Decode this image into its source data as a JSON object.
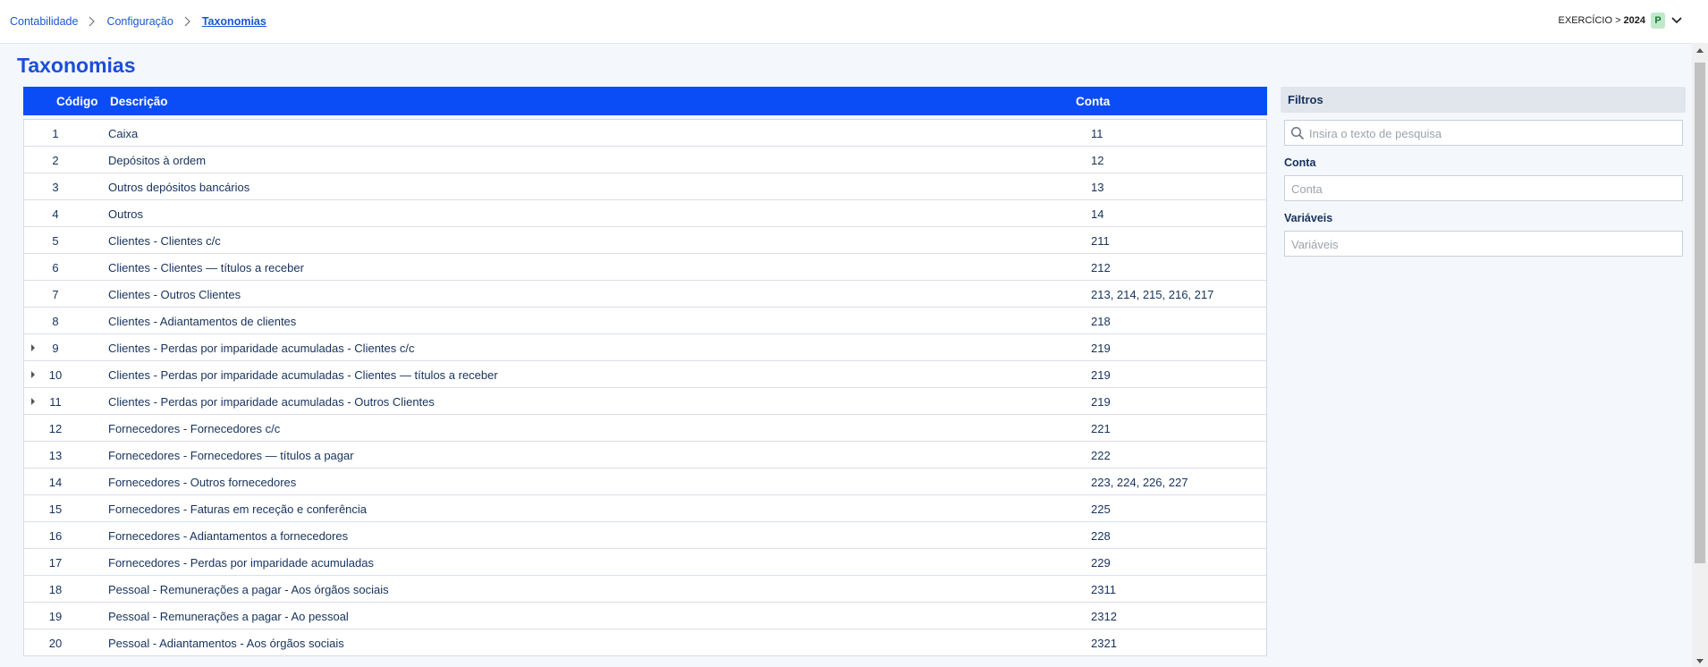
{
  "breadcrumb": {
    "items": [
      "Contabilidade",
      "Configuração",
      "Taxonomias"
    ]
  },
  "exercise": {
    "label": "EXERCÍCIO >",
    "year": "2024",
    "badge": "P"
  },
  "page": {
    "title": "Taxonomias"
  },
  "table": {
    "headers": {
      "code": "Código",
      "description": "Descrição",
      "account": "Conta"
    },
    "rows": [
      {
        "code": "1",
        "description": "Caixa",
        "account": "11",
        "expandable": false
      },
      {
        "code": "2",
        "description": "Depósitos à ordem",
        "account": "12",
        "expandable": false
      },
      {
        "code": "3",
        "description": "Outros depósitos bancários",
        "account": "13",
        "expandable": false
      },
      {
        "code": "4",
        "description": "Outros",
        "account": "14",
        "expandable": false
      },
      {
        "code": "5",
        "description": "Clientes - Clientes c/c",
        "account": "211",
        "expandable": false
      },
      {
        "code": "6",
        "description": "Clientes - Clientes — títulos a receber",
        "account": "212",
        "expandable": false
      },
      {
        "code": "7",
        "description": "Clientes - Outros Clientes",
        "account": "213, 214, 215, 216, 217",
        "expandable": false
      },
      {
        "code": "8",
        "description": "Clientes - Adiantamentos de clientes",
        "account": "218",
        "expandable": false
      },
      {
        "code": "9",
        "description": "Clientes - Perdas por imparidade acumuladas - Clientes c/c",
        "account": "219",
        "expandable": true
      },
      {
        "code": "10",
        "description": "Clientes - Perdas por imparidade acumuladas - Clientes — títulos a receber",
        "account": "219",
        "expandable": true
      },
      {
        "code": "11",
        "description": "Clientes - Perdas por imparidade acumuladas - Outros Clientes",
        "account": "219",
        "expandable": true
      },
      {
        "code": "12",
        "description": "Fornecedores - Fornecedores c/c",
        "account": "221",
        "expandable": false
      },
      {
        "code": "13",
        "description": "Fornecedores - Fornecedores — títulos a pagar",
        "account": "222",
        "expandable": false
      },
      {
        "code": "14",
        "description": "Fornecedores - Outros fornecedores",
        "account": "223, 224, 226, 227",
        "expandable": false
      },
      {
        "code": "15",
        "description": "Fornecedores - Faturas em receção e conferência",
        "account": "225",
        "expandable": false
      },
      {
        "code": "16",
        "description": "Fornecedores - Adiantamentos a fornecedores",
        "account": "228",
        "expandable": false
      },
      {
        "code": "17",
        "description": "Fornecedores - Perdas por imparidade acumuladas",
        "account": "229",
        "expandable": false
      },
      {
        "code": "18",
        "description": "Pessoal - Remunerações a pagar - Aos órgãos sociais",
        "account": "2311",
        "expandable": false
      },
      {
        "code": "19",
        "description": "Pessoal - Remunerações a pagar - Ao pessoal",
        "account": "2312",
        "expandable": false
      },
      {
        "code": "20",
        "description": "Pessoal - Adiantamentos - Aos órgãos sociais",
        "account": "2321",
        "expandable": false
      }
    ]
  },
  "filters": {
    "title": "Filtros",
    "search_placeholder": "Insira o texto de pesquisa",
    "conta_label": "Conta",
    "conta_placeholder": "Conta",
    "variaveis_label": "Variáveis",
    "variaveis_placeholder": "Variáveis"
  },
  "icons": {
    "separator": "chevron-right-icon",
    "dropdown": "chevron-down-icon",
    "search": "search-icon",
    "expand": "caret-right-icon"
  },
  "colors": {
    "accent": "#0a4df7",
    "title": "#1a4fd8",
    "link": "#1a56d6",
    "badge_bg": "#bfe9c9",
    "badge_fg": "#18773a"
  }
}
